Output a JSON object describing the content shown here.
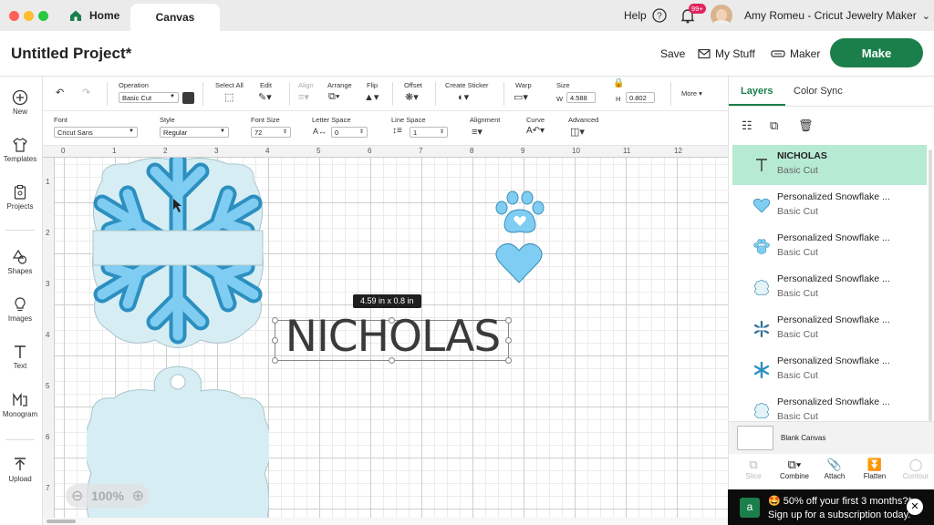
{
  "window": {
    "tabs": [
      {
        "label": "Home"
      },
      {
        "label": "Canvas"
      }
    ],
    "help_label": "Help",
    "notification_count": "99+",
    "user_name": "Amy Romeu - Cricut Jewelry Maker"
  },
  "header": {
    "project_title": "Untitled Project*",
    "save_label": "Save",
    "mystuff_label": "My Stuff",
    "machine_label": "Maker",
    "make_label": "Make"
  },
  "left_tools": [
    "New",
    "Templates",
    "Projects",
    "Shapes",
    "Images",
    "Text",
    "Monogram",
    "Upload"
  ],
  "toolbar1": {
    "operation_label": "Operation",
    "operation_value": "Basic Cut",
    "select_all": "Select All",
    "edit": "Edit",
    "align": "Align",
    "arrange": "Arrange",
    "flip": "Flip",
    "offset": "Offset",
    "create_sticker": "Create Sticker",
    "warp": "Warp",
    "size": "Size",
    "w_label": "W",
    "w_value": "4.588",
    "h_label": "H",
    "h_value": "0.802",
    "more": "More"
  },
  "toolbar2": {
    "font_label": "Font",
    "font_value": "Cricut Sans",
    "style_label": "Style",
    "style_value": "Regular",
    "fontsize_label": "Font Size",
    "fontsize_value": "72",
    "letterspace_label": "Letter Space",
    "letterspace_value": "0",
    "linespace_label": "Line Space",
    "linespace_value": "1",
    "alignment_label": "Alignment",
    "curve_label": "Curve",
    "advanced_label": "Advanced"
  },
  "ruler": {
    "top": [
      "0",
      "1",
      "2",
      "3",
      "4",
      "5",
      "6",
      "7",
      "8",
      "9",
      "10",
      "11",
      "12"
    ],
    "left": [
      "1",
      "2",
      "3",
      "4",
      "5",
      "6",
      "7"
    ]
  },
  "canvas": {
    "dimension_tooltip": "4.59  in x 0.8  in",
    "text_object": "NICHOLAS",
    "zoom": "100%"
  },
  "right_panel": {
    "tabs": [
      {
        "label": "Layers"
      },
      {
        "label": "Color Sync"
      }
    ],
    "layers": [
      {
        "name": "NICHOLAS",
        "op": "Basic Cut",
        "icon": "text-icon"
      },
      {
        "name": "Personalized Snowflake ...",
        "op": "Basic Cut",
        "icon": "heart-icon"
      },
      {
        "name": "Personalized Snowflake ...",
        "op": "Basic Cut",
        "icon": "paw-icon"
      },
      {
        "name": "Personalized Snowflake ...",
        "op": "Basic Cut",
        "icon": "tag-outline-icon"
      },
      {
        "name": "Personalized Snowflake ...",
        "op": "Basic Cut",
        "icon": "snowflake-icon"
      },
      {
        "name": "Personalized Snowflake ...",
        "op": "Basic Cut",
        "icon": "snowflake-icon"
      },
      {
        "name": "Personalized Snowflake ...",
        "op": "Basic Cut",
        "icon": "tag-outline-icon"
      }
    ],
    "blank_canvas": "Blank Canvas",
    "bottom_tools": [
      "Slice",
      "Combine",
      "Attach",
      "Flatten",
      "Contour"
    ]
  },
  "promo": {
    "line1": "🤩 50% off your first 3 months?*",
    "line2": "Sign up for a subscription today."
  },
  "colors": {
    "accent": "#1a7f4b",
    "selected_layer": "#b6ead3",
    "snowflake_light": "#7fcdf2",
    "snowflake_dark": "#2c8fc0",
    "tag_fill": "#d6eef3"
  }
}
